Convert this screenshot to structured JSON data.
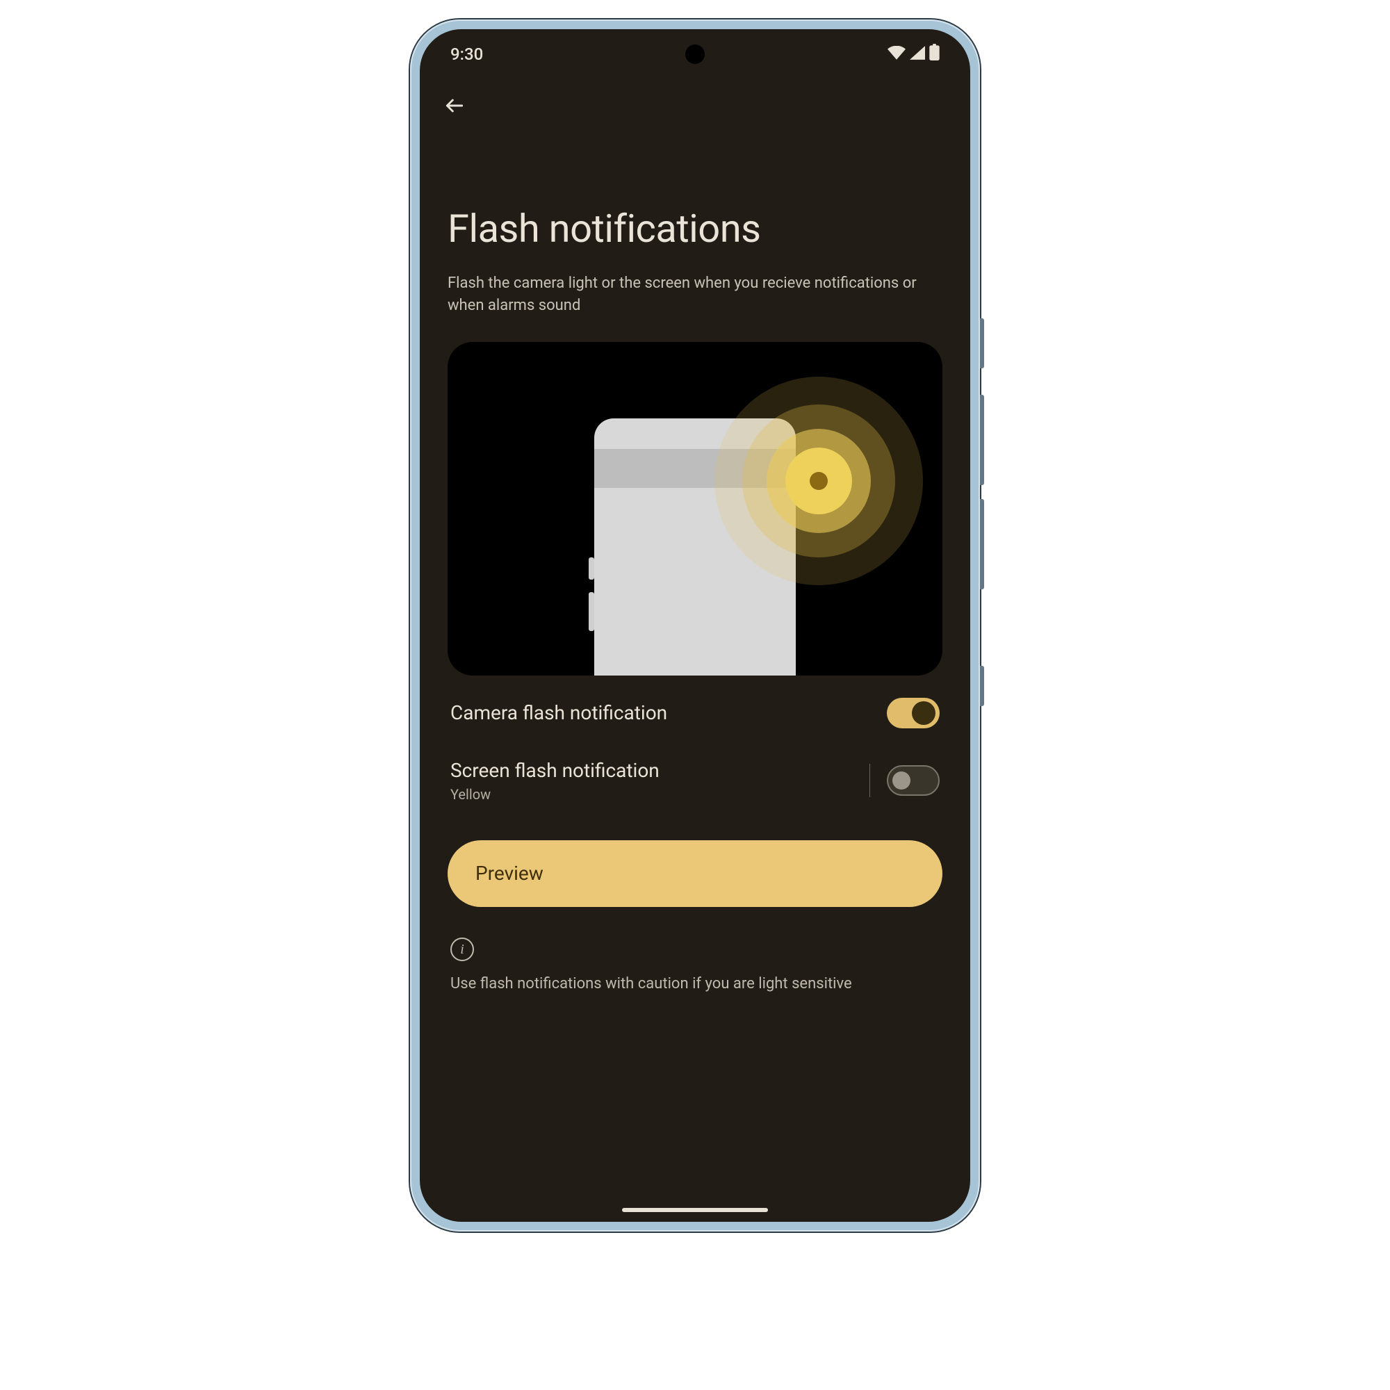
{
  "status": {
    "time": "9:30"
  },
  "header": {
    "title": "Flash notifications",
    "description": "Flash the camera light or the screen when you recieve notifications or when alarms sound"
  },
  "settings": {
    "camera_flash": {
      "label": "Camera flash notification",
      "enabled": true
    },
    "screen_flash": {
      "label": "Screen flash notification",
      "sub": "Yellow",
      "enabled": false
    }
  },
  "preview": {
    "label": "Preview"
  },
  "caution": {
    "text": "Use flash notifications with caution if you are light sensitive"
  },
  "colors": {
    "accent": "#e1bc6b",
    "bg": "#211d16"
  }
}
